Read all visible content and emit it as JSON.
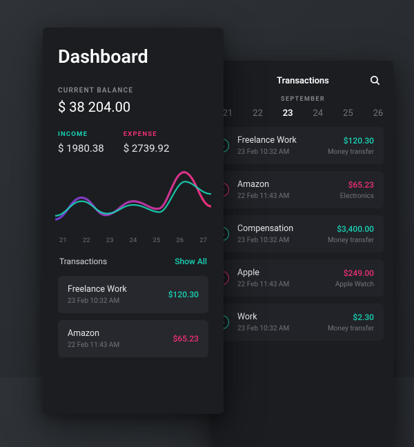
{
  "colors": {
    "income": "#19d3b5",
    "expense": "#ef2f78"
  },
  "dashboard": {
    "title": "Dashboard",
    "balance_label": "CURRENT BALANCE",
    "balance": "$ 38 204.00",
    "income_label": "INCOME",
    "income": "$ 1980.38",
    "expense_label": "EXPENSE",
    "expense": "$ 2739.92",
    "axis": [
      "21",
      "22",
      "23",
      "24",
      "25",
      "26",
      "27"
    ],
    "transactions_label": "Transactions",
    "show_all": "Show All",
    "items": [
      {
        "title": "Freelance Work",
        "date": "23 Feb 10:32 AM",
        "amount": "$120.30",
        "sign": "pos"
      },
      {
        "title": "Amazon",
        "date": "22 Feb 11:43 AM",
        "amount": "$65.23",
        "sign": "neg"
      }
    ]
  },
  "chart_data": {
    "type": "line",
    "categories": [
      "21",
      "22",
      "23",
      "24",
      "25",
      "26",
      "27"
    ],
    "series": [
      {
        "name": "Income",
        "values": [
          25,
          45,
          28,
          40,
          30,
          72,
          55
        ]
      },
      {
        "name": "Expense",
        "values": [
          20,
          50,
          26,
          45,
          35,
          85,
          38
        ]
      }
    ],
    "xlabel": "",
    "ylabel": "",
    "ylim": [
      0,
      100
    ],
    "legend": false
  },
  "transactions": {
    "title": "Transactions",
    "month": "SEPTEMBER",
    "dates": [
      "21",
      "22",
      "23",
      "24",
      "25",
      "26"
    ],
    "selected_date": "23",
    "items": [
      {
        "title": "Freelance Work",
        "date": "23 Feb 10:32 AM",
        "amount": "$120.30",
        "category": "Money transfer",
        "sign": "pos"
      },
      {
        "title": "Amazon",
        "date": "22 Feb 11:43 AM",
        "amount": "$65.23",
        "category": "Electronics",
        "sign": "neg"
      },
      {
        "title": "Compensation",
        "date": "23 Feb 10:32 AM",
        "amount": "$3,400.00",
        "category": "Money transfer",
        "sign": "pos"
      },
      {
        "title": "Apple",
        "date": "22 Feb 11:43 AM",
        "amount": "$249.00",
        "category": "Apple Watch",
        "sign": "neg"
      },
      {
        "title": "Work",
        "date": "23 Feb 10:32 AM",
        "amount": "$2.30",
        "category": "Money transfer",
        "sign": "pos"
      }
    ]
  }
}
